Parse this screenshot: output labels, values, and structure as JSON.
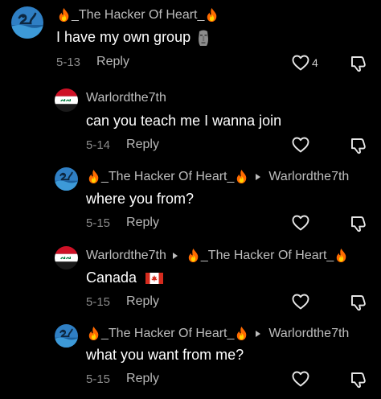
{
  "comments": [
    {
      "author": "_The Hacker Of Heart_",
      "text": "I have my own group",
      "date": "5-13",
      "reply_label": "Reply",
      "like_count": "4"
    },
    {
      "author": "Warlordthe7th",
      "text": "can you teach me I wanna join",
      "date": "5-14",
      "reply_label": "Reply"
    },
    {
      "author": "_The Hacker Of Heart_",
      "reply_to": "Warlordthe7th",
      "text": "where you from?",
      "date": "5-15",
      "reply_label": "Reply"
    },
    {
      "author": "Warlordthe7th",
      "reply_to": "_The Hacker Of Heart_",
      "text": "Canada",
      "date": "5-15",
      "reply_label": "Reply"
    },
    {
      "author": "_The Hacker Of Heart_",
      "reply_to": "Warlordthe7th",
      "text": "what you want from me?",
      "date": "5-15",
      "reply_label": "Reply"
    }
  ],
  "icons": {
    "fire": "fire-emoji",
    "moai": "moai-emoji",
    "canada_flag": "canada-flag-emoji",
    "like": "heart-outline-icon",
    "dislike": "thumbs-down-outline-icon",
    "reply_arrow": "triangle-right-icon"
  },
  "colors": {
    "background": "#000000",
    "author": "#bdbdbd",
    "text": "#ffffff",
    "meta": "#8a8a8a"
  }
}
